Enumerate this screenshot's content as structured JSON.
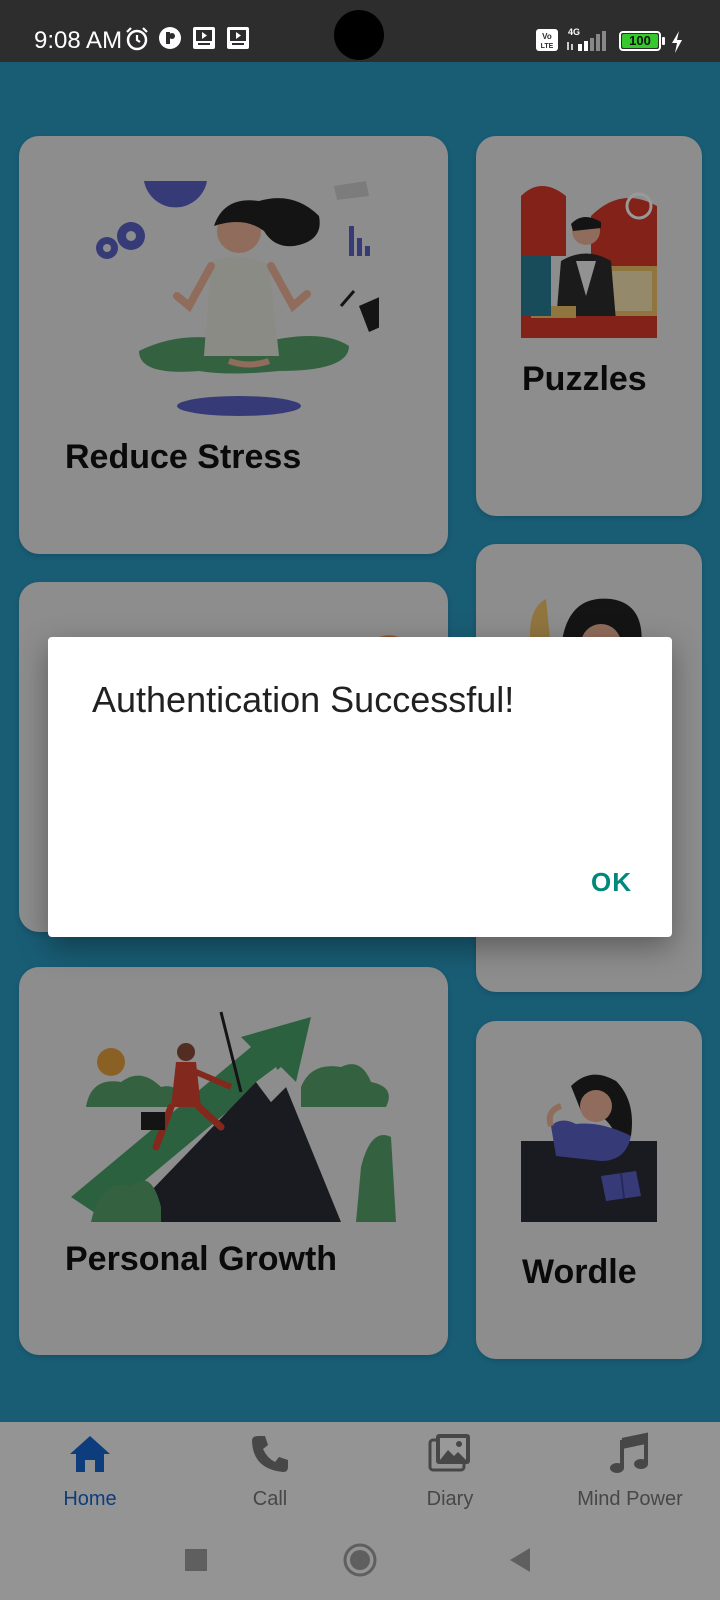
{
  "status_bar": {
    "time": "9:08 AM",
    "battery": "100",
    "network": "4G",
    "icons": [
      "alarm-icon",
      "app-notification-icon",
      "video-icon",
      "video-icon",
      "volte-icon",
      "signal-icon",
      "battery-icon",
      "charging-icon"
    ]
  },
  "cards": {
    "reduce_stress": {
      "label": "Reduce Stress"
    },
    "puzzles": {
      "label": "Puzzles"
    },
    "personal_growth": {
      "label": "Personal Growth"
    },
    "wordle": {
      "label": "Wordle"
    }
  },
  "bottom_nav": {
    "items": [
      {
        "label": "Home",
        "icon": "home-icon",
        "active": true
      },
      {
        "label": "Call",
        "icon": "phone-icon",
        "active": false
      },
      {
        "label": "Diary",
        "icon": "gallery-icon",
        "active": false
      },
      {
        "label": "Mind Power",
        "icon": "music-note-icon",
        "active": false
      }
    ]
  },
  "dialog": {
    "title": "Authentication Successful!",
    "ok_label": "OK"
  },
  "colors": {
    "background": "#2a9bc4",
    "card": "#ececec",
    "active_nav": "#1666d1",
    "dialog_button": "#00897b",
    "battery": "#35c92b"
  }
}
